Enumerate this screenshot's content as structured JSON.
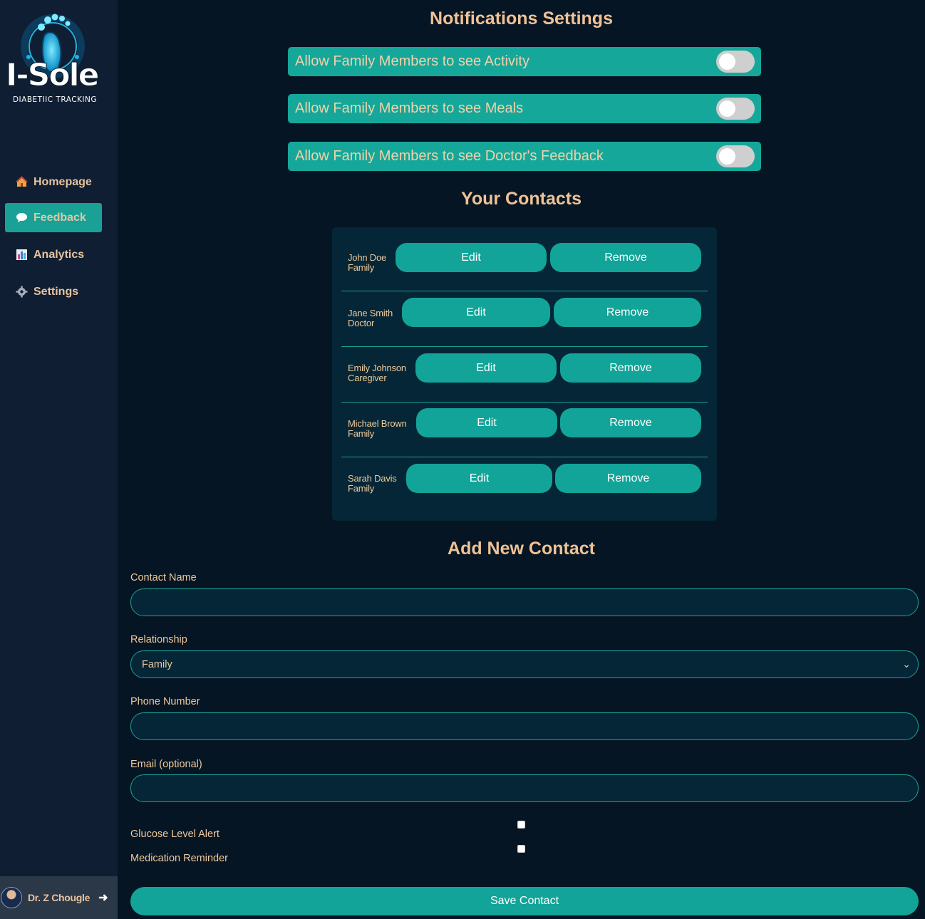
{
  "brand": {
    "name": "I-Sole",
    "subtitle": "DIABETIIC TRACKING"
  },
  "sidebar": {
    "items": [
      {
        "label": "Homepage",
        "icon": "house-icon",
        "active": false
      },
      {
        "label": "Feedback",
        "icon": "speech-bubble-icon",
        "active": true
      },
      {
        "label": "Analytics",
        "icon": "bar-chart-icon",
        "active": false
      },
      {
        "label": "Settings",
        "icon": "gear-icon",
        "active": false
      }
    ],
    "user": {
      "name": "Dr. Z Chougle",
      "logout_icon": "arrow-right-icon"
    }
  },
  "notifications": {
    "title": "Notifications Settings",
    "toggles": [
      {
        "label": "Allow Family Members to see Activity",
        "on": false
      },
      {
        "label": "Allow Family Members to see Meals",
        "on": false
      },
      {
        "label": "Allow Family Members to see Doctor's Feedback",
        "on": false
      }
    ]
  },
  "contacts": {
    "title": "Your Contacts",
    "edit_label": "Edit",
    "remove_label": "Remove",
    "list": [
      {
        "name": "John Doe",
        "relationship": "Family"
      },
      {
        "name": "Jane Smith",
        "relationship": "Doctor"
      },
      {
        "name": "Emily Johnson",
        "relationship": "Caregiver"
      },
      {
        "name": "Michael Brown",
        "relationship": "Family"
      },
      {
        "name": "Sarah Davis",
        "relationship": "Family"
      }
    ]
  },
  "add_contact": {
    "title": "Add New Contact",
    "name_label": "Contact Name",
    "name_value": "",
    "relationship_label": "Relationship",
    "relationship_value": "Family",
    "phone_label": "Phone Number",
    "phone_value": "",
    "email_label": "Email (optional)",
    "email_value": "",
    "glucose_label": "Glucose Level Alert",
    "glucose_checked": false,
    "medication_label": "Medication Reminder",
    "medication_checked": false,
    "save_label": "Save Contact"
  },
  "colors": {
    "accent": "#16a79b",
    "background": "#061523",
    "sidebar": "#0f1e33",
    "text": "#efc296"
  }
}
